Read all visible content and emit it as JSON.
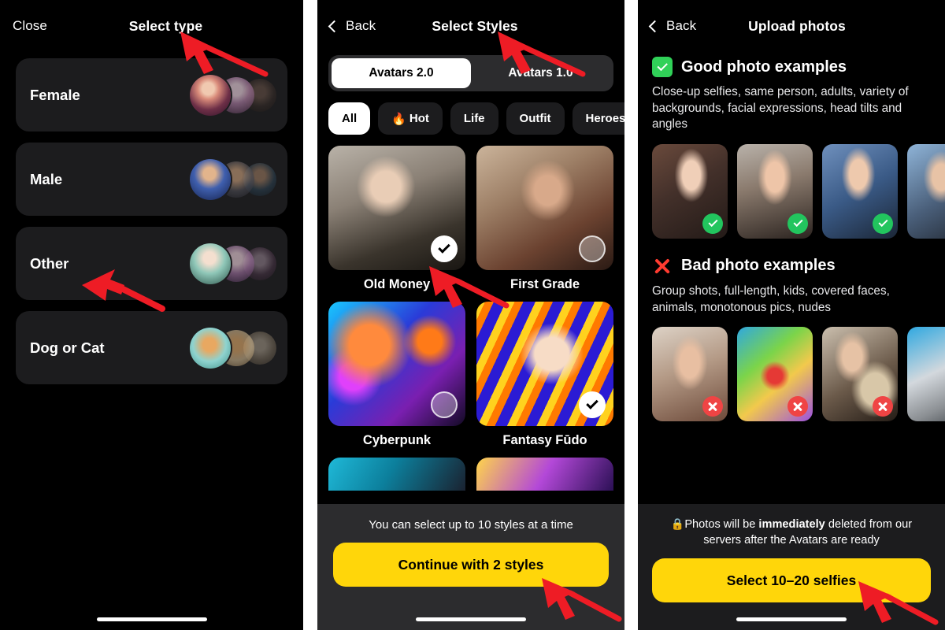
{
  "panel1": {
    "nav": {
      "close_label": "Close",
      "title": "Select type"
    },
    "options": [
      {
        "label": "Female"
      },
      {
        "label": "Male"
      },
      {
        "label": "Other"
      },
      {
        "label": "Dog or Cat"
      }
    ]
  },
  "panel2": {
    "nav": {
      "back_label": "Back",
      "title": "Select Styles"
    },
    "segments": [
      {
        "label": "Avatars 2.0",
        "active": true
      },
      {
        "label": "Avatars 1.0",
        "active": false
      }
    ],
    "chips": [
      {
        "label": "All",
        "icon": "",
        "active": true
      },
      {
        "label": "Hot",
        "icon": "🔥",
        "active": false
      },
      {
        "label": "Life",
        "icon": "",
        "active": false
      },
      {
        "label": "Outfit",
        "icon": "",
        "active": false
      },
      {
        "label": "Heroes",
        "icon": "",
        "active": false
      }
    ],
    "styles": [
      {
        "name": "Old Money",
        "selected": true
      },
      {
        "name": "First Grade",
        "selected": false
      },
      {
        "name": "Cyberpunk",
        "selected": false
      },
      {
        "name": "Fantasy Fūdo",
        "selected": true
      }
    ],
    "sheet": {
      "hint": "You can select up to 10 styles at a time",
      "cta": "Continue with 2 styles"
    }
  },
  "panel3": {
    "nav": {
      "back_label": "Back",
      "title": "Upload photos"
    },
    "good": {
      "title": "Good photo examples",
      "desc": "Close-up selfies, same person, adults, variety of backgrounds, facial expressions, head tilts and angles"
    },
    "bad": {
      "title": "Bad photo examples",
      "desc": "Group shots, full-length, kids, covered faces, animals, monotonous pics, nudes"
    },
    "privacy": {
      "lock": "🔒",
      "prefix": "Photos will be ",
      "emphasis": "immediately",
      "suffix": " deleted from our servers after the Avatars are ready"
    },
    "cta": "Select 10–20 selfies"
  },
  "colors": {
    "background": "#000000",
    "card": "#1c1c1e",
    "sheet": "#2c2c2e",
    "accent_yellow": "#ffd60a",
    "good_green": "#30d158",
    "bad_red": "#ff3b30",
    "arrow_red": "#ee1c25",
    "divider": "#ffffff"
  },
  "annotations": [
    {
      "name": "arrow-select-type"
    },
    {
      "name": "arrow-other-option"
    },
    {
      "name": "arrow-select-styles"
    },
    {
      "name": "arrow-old-money-check"
    },
    {
      "name": "arrow-continue-button"
    },
    {
      "name": "arrow-select-selfies-button"
    }
  ]
}
